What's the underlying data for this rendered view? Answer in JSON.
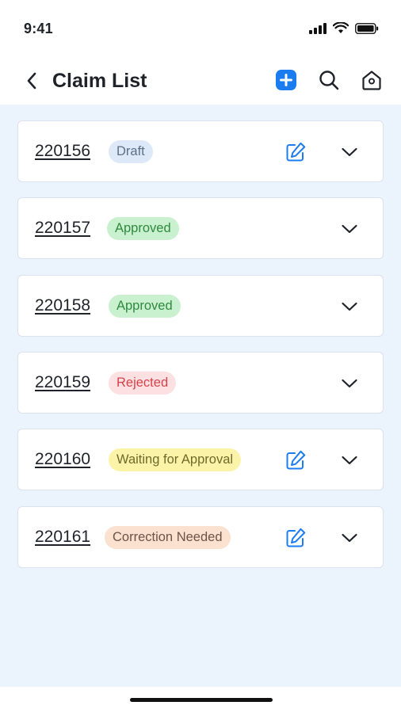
{
  "status_bar": {
    "time": "9:41",
    "icons": [
      "signal-icon",
      "wifi-icon",
      "battery-icon"
    ]
  },
  "header": {
    "title": "Claim List",
    "icons": {
      "back": "chevron-left-icon",
      "add": "plus-square-icon",
      "search": "search-icon",
      "home": "home-icon"
    },
    "accent_color": "#1a7cf0"
  },
  "claims": [
    {
      "id": "220156",
      "status": "Draft",
      "status_bg": "#dde9f8",
      "status_color": "#5b6f88",
      "editable": true
    },
    {
      "id": "220157",
      "status": "Approved",
      "status_bg": "#c9f0cf",
      "status_color": "#2f8a3f",
      "editable": false
    },
    {
      "id": "220158",
      "status": "Approved",
      "status_bg": "#c9f0cf",
      "status_color": "#2f8a3f",
      "editable": false
    },
    {
      "id": "220159",
      "status": "Rejected",
      "status_bg": "#fde0e1",
      "status_color": "#d6424c",
      "editable": false
    },
    {
      "id": "220160",
      "status": "Waiting for Approval",
      "status_bg": "#fbf4a8",
      "status_color": "#6f6a2c",
      "editable": true
    },
    {
      "id": "220161",
      "status": "Correction Needed",
      "status_bg": "#fbe1cf",
      "status_color": "#6b5448",
      "editable": true
    }
  ]
}
